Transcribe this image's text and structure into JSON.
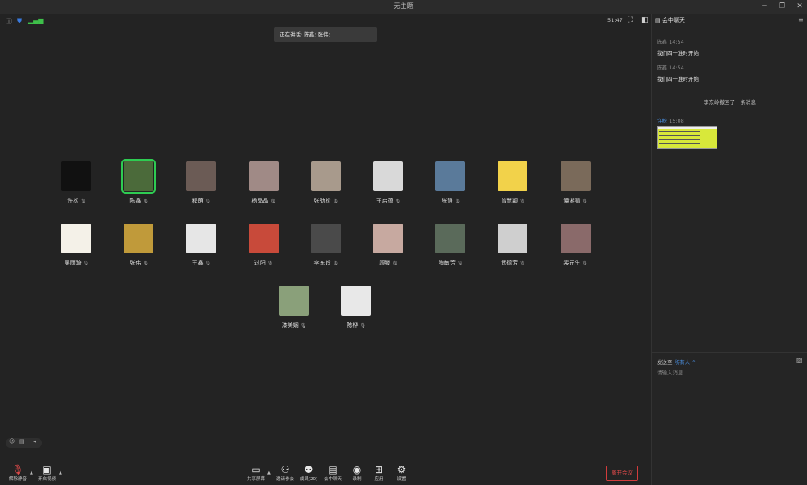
{
  "window": {
    "title": "无主题",
    "minimize": "─",
    "restore": "❐",
    "close": "✕"
  },
  "meeting": {
    "timer": "51:47",
    "speaking": "正在讲话: 陈鑫; 张伟;",
    "participants": [
      {
        "name": "许松",
        "bg": "#111111"
      },
      {
        "name": "陈鑫",
        "bg": "#4b6a3a",
        "active": true
      },
      {
        "name": "程萌",
        "bg": "#6b5b55"
      },
      {
        "name": "杨晶晶",
        "bg": "#a08a86"
      },
      {
        "name": "张劲松",
        "bg": "#a89a8c"
      },
      {
        "name": "王启蕴",
        "bg": "#d9d9d9"
      },
      {
        "name": "张静",
        "bg": "#5a7a9a"
      },
      {
        "name": "曾慧颖",
        "bg": "#f2d24a"
      },
      {
        "name": "谭湘猜",
        "bg": "#7a6a5a"
      },
      {
        "name": "吴雨琦",
        "bg": "#f4f1e8"
      },
      {
        "name": "张伟",
        "bg": "#c09a3a"
      },
      {
        "name": "王鑫",
        "bg": "#e6e6e6"
      },
      {
        "name": "过阳",
        "bg": "#c84a3a"
      },
      {
        "name": "李东岭",
        "bg": "#4a4a4a"
      },
      {
        "name": "顾滕",
        "bg": "#c7a9a0"
      },
      {
        "name": "陶敏芳",
        "bg": "#5a6a5a"
      },
      {
        "name": "武德芳",
        "bg": "#cfcfcf"
      },
      {
        "name": "裴元生",
        "bg": "#8a6a6a"
      },
      {
        "name": "漆美娴",
        "bg": "#8aa07a"
      },
      {
        "name": "陈桦",
        "bg": "#e8e8e8"
      }
    ]
  },
  "chat": {
    "header": "会中聊天",
    "messages": [
      {
        "sender": "陈鑫",
        "time": "14:54",
        "text": "我们四十准时开始"
      },
      {
        "sender": "陈鑫",
        "time": "14:54",
        "text": "我们四十准时开始"
      }
    ],
    "recall": "李东岭撤回了一条消息",
    "image_msg": {
      "sender": "许松",
      "time": "15:08"
    },
    "send_to_label": "发送至",
    "send_to_value": "所有人 ⌃",
    "placeholder": "请输入消息..."
  },
  "toolbar": {
    "unmute": "解除静音",
    "start_video": "开启视频",
    "share": "共享屏幕",
    "invite": "邀请参会",
    "members": "成员(20)",
    "chat": "会中聊天",
    "record": "录制",
    "apps": "应用",
    "settings": "设置",
    "leave": "离开会议"
  },
  "colors": {
    "active_border": "#2ecc52",
    "leave": "#e04a4a",
    "link": "#4a8fe0"
  }
}
